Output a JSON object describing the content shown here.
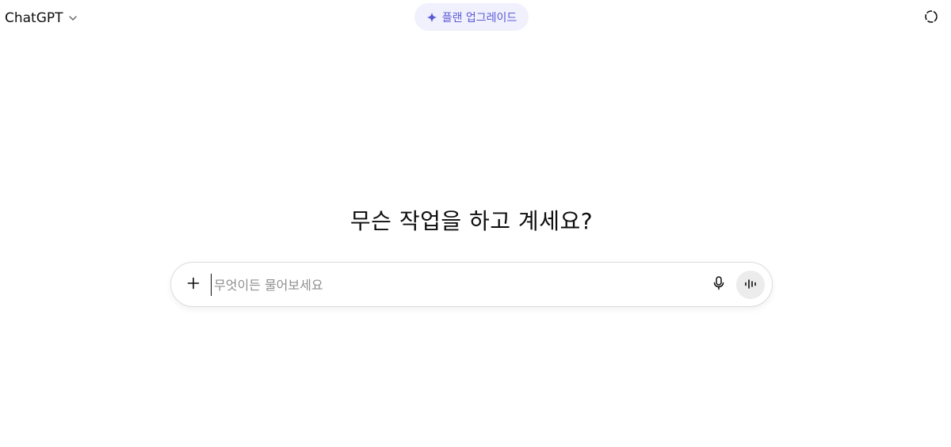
{
  "header": {
    "model_name": "ChatGPT",
    "upgrade_label": "플랜 업그레이드",
    "icons": {
      "model_chevron": "chevron-down-icon",
      "upgrade": "sparkle-icon",
      "temporary_chat": "dashed-circle-icon"
    }
  },
  "main": {
    "headline": "무슨 작업을 하고 계세요?",
    "composer": {
      "placeholder": "무엇이든 물어보세요",
      "value": "",
      "icons": {
        "add": "plus-icon",
        "dictate": "microphone-icon",
        "voice_mode": "voice-waveform-icon"
      }
    }
  },
  "colors": {
    "accent": "#5b5bd6",
    "upgrade_bg": "#f1f0fd",
    "voice_btn_bg": "#ececec",
    "text": "#0d0d0d",
    "placeholder": "#8f8f8f"
  }
}
